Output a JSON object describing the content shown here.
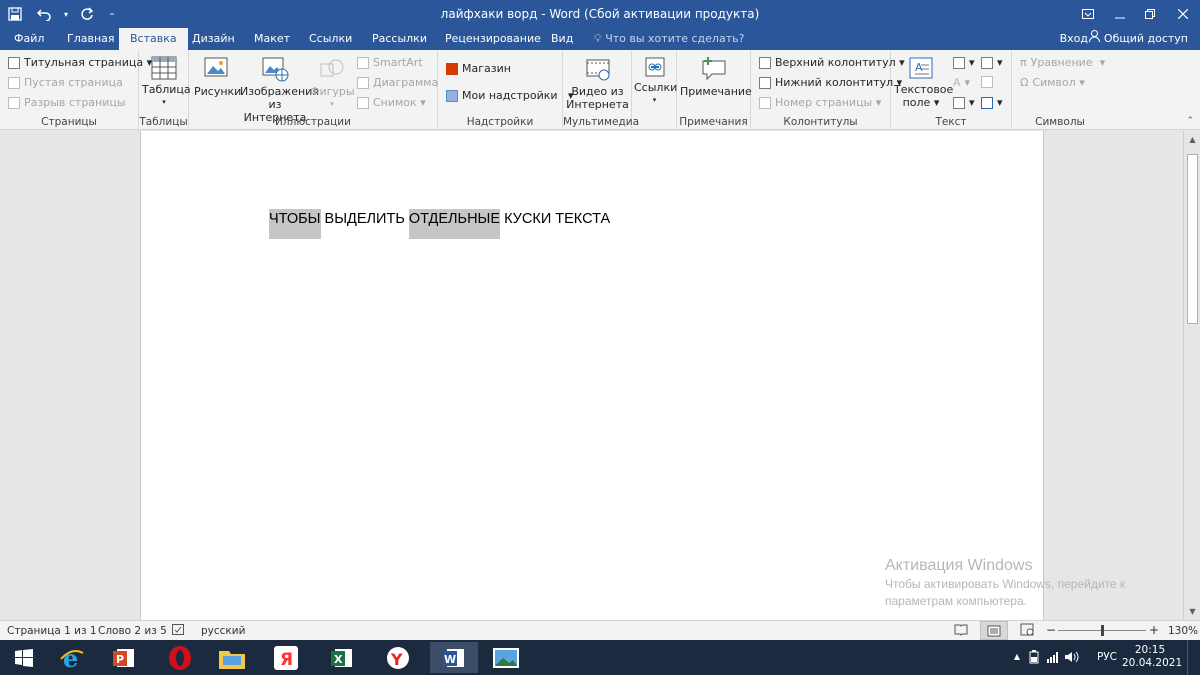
{
  "titlebar": {
    "title": "лайфхаки ворд - Word (Сбой активации продукта)",
    "qat": [
      "save-icon",
      "undo-icon",
      "redo-icon",
      "customize-icon"
    ],
    "window_controls": [
      "ribbon-display-icon",
      "minimize-icon",
      "restore-icon",
      "close-icon"
    ]
  },
  "tabs": {
    "items": [
      "Файл",
      "Главная",
      "Вставка",
      "Дизайн",
      "Макет",
      "Ссылки",
      "Рассылки",
      "Рецензирование",
      "Вид"
    ],
    "active": "Вставка",
    "tell_me": "Что вы хотите сделать?",
    "signin": "Вход",
    "share": "Общий доступ"
  },
  "ribbon": {
    "pages": {
      "cover": "Титульная страница",
      "blank": "Пустая страница",
      "break": "Разрыв страницы",
      "label": "Страницы"
    },
    "tables": {
      "table": "Таблица",
      "label": "Таблицы"
    },
    "illustrations": {
      "pictures": "Рисунки",
      "online_pictures_1": "Изображения",
      "online_pictures_2": "из Интернета",
      "shapes": "Фигуры",
      "smartart": "SmartArt",
      "chart": "Диаграмма",
      "screenshot": "Снимок",
      "label": "Иллюстрации"
    },
    "addins": {
      "store": "Магазин",
      "my_addins": "Мои надстройки",
      "label": "Надстройки"
    },
    "media": {
      "video_1": "Видео из",
      "video_2": "Интернета",
      "label": "Мультимедиа"
    },
    "links": {
      "links": "Ссылки"
    },
    "comments": {
      "comment": "Примечание",
      "label": "Примечания"
    },
    "headerfooter": {
      "header": "Верхний колонтитул",
      "footer": "Нижний колонтитул",
      "page_number": "Номер страницы",
      "label": "Колонтитулы"
    },
    "text": {
      "textbox_1": "Текстовое",
      "textbox_2": "поле",
      "label": "Текст"
    },
    "symbols": {
      "equation": "Уравнение",
      "symbol": "Символ",
      "label": "Символы"
    }
  },
  "document": {
    "segments": [
      {
        "text": "ЧТОБЫ",
        "highlighted": true
      },
      {
        "text": " ВЫДЕЛИТЬ ",
        "highlighted": false
      },
      {
        "text": "ОТДЕЛЬНЫЕ",
        "highlighted": true
      },
      {
        "text": " КУСКИ ТЕКСТА",
        "highlighted": false
      }
    ]
  },
  "activation": {
    "line1": "Активация Windows",
    "line2": "Чтобы активировать Windows, перейдите к",
    "line3": "параметрам компьютера."
  },
  "statusbar": {
    "page": "Страница 1 из 1",
    "words": "Слово 2 из 5",
    "language": "русский",
    "zoom": "130%",
    "zoom_minus": "−",
    "zoom_plus": "+"
  },
  "taskbar": {
    "apps": [
      "start-icon",
      "internet-explorer-icon",
      "powerpoint-icon",
      "opera-icon",
      "file-explorer-icon",
      "yandex-icon",
      "excel-icon",
      "yandex-browser-icon",
      "word-icon",
      "photos-icon"
    ],
    "active": "word-icon",
    "lang": "РУС",
    "time": "20:15",
    "date": "20.04.2021"
  },
  "colors": {
    "accent": "#2b579a",
    "highlight": "#c6c6c6",
    "taskbar": "#1b2a3f"
  }
}
